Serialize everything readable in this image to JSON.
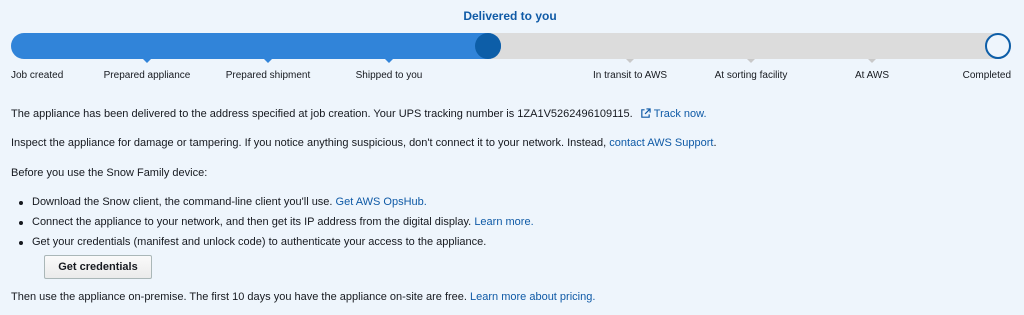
{
  "status": {
    "title": "Delivered to you",
    "progress_fraction": 0.49
  },
  "steps": [
    {
      "label": "Job created",
      "state": "done"
    },
    {
      "label": "Prepared appliance",
      "state": "done"
    },
    {
      "label": "Prepared shipment",
      "state": "done"
    },
    {
      "label": "Shipped to you",
      "state": "done"
    },
    {
      "label": "In transit to AWS",
      "state": "pending"
    },
    {
      "label": "At sorting facility",
      "state": "pending"
    },
    {
      "label": "At AWS",
      "state": "pending"
    },
    {
      "label": "Completed",
      "state": "pending"
    }
  ],
  "delivery": {
    "text": "The appliance has been delivered to the address specified at job creation. Your UPS tracking number is 1ZA1V5262496109115.",
    "track_link": "Track now."
  },
  "inspect": {
    "text": "Inspect the appliance for damage or tampering. If you notice anything suspicious, don't connect it to your network. Instead,",
    "support_link": "contact AWS Support",
    "end": "."
  },
  "before": {
    "text": "Before you use the Snow Family device:"
  },
  "bullets": [
    {
      "text": "Download the Snow client, the command-line client you'll use.",
      "link": "Get AWS OpsHub."
    },
    {
      "text": "Connect the appliance to your network, and then get its IP address from the digital display.",
      "link": "Learn more."
    },
    {
      "text": "Get your credentials (manifest and unlock code) to authenticate your access to the appliance.",
      "link": ""
    }
  ],
  "credentials_button": "Get credentials",
  "onsite": {
    "text": "Then use the appliance on-premise. The first 10 days you have the appliance on-site are free.",
    "pricing_link": "Learn more about pricing."
  },
  "colors": {
    "accent": "#0f5aa6",
    "progress_fill": "#3184d9",
    "progress_track": "#dcdcdc",
    "background": "#eef5fc"
  },
  "icons": {
    "track_link_icon": "external-link-icon"
  }
}
